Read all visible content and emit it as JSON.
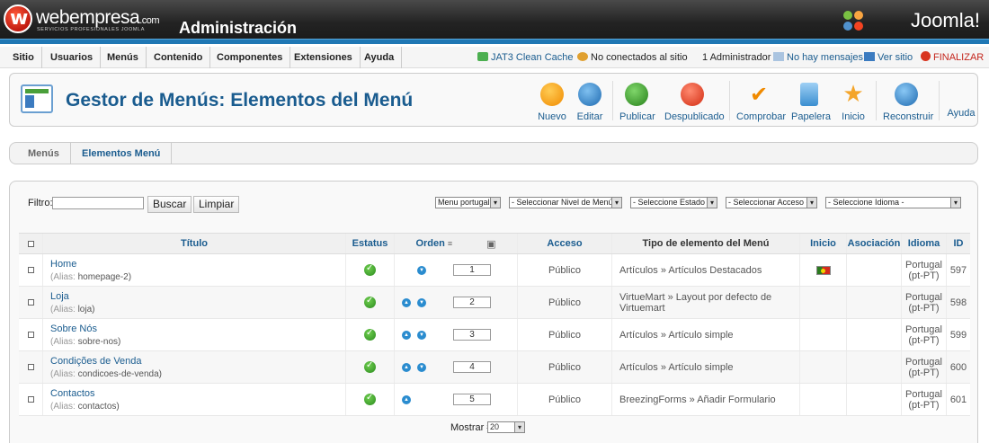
{
  "header": {
    "brand": "webempresa",
    "brand_suffix": ".com",
    "brand_tagline": "SERVICIOS PROFESIONALES JOOMLA",
    "admin_title": "Administración",
    "joomla_logo": "Joomla!"
  },
  "menubar": {
    "items": [
      "Sitio",
      "Usuarios",
      "Menús",
      "Contenido",
      "Componentes",
      "Extensiones",
      "Ayuda"
    ],
    "status": {
      "cache": "JAT3 Clean Cache",
      "visitors": "No conectados al sitio",
      "admins": "1 Administrador",
      "messages": "No hay mensajes",
      "view_site": "Ver sitio",
      "logout": "FINALIZAR"
    }
  },
  "toolbar": {
    "title": "Gestor de Menús: Elementos del Menú",
    "buttons": {
      "new": "Nuevo",
      "edit": "Editar",
      "publish": "Publicar",
      "unpublish": "Despublicado",
      "checkin": "Comprobar",
      "trash": "Papelera",
      "home": "Inicio",
      "rebuild": "Reconstruir",
      "help": "Ayuda"
    }
  },
  "tabs": {
    "menus": "Menús",
    "items": "Elementos Menú"
  },
  "filters": {
    "label": "Filtro:",
    "search_btn": "Buscar",
    "clear_btn": "Limpiar",
    "menu_select": "Menu portugal",
    "level_select": "- Seleccionar Nivel de Menú -",
    "state_select": "- Seleccione Estado -",
    "access_select": "- Seleccionar Acceso -",
    "language_select": "- Seleccione Idioma -"
  },
  "table": {
    "headers": {
      "title": "Título",
      "status": "Estatus",
      "order": "Orden",
      "access": "Acceso",
      "type": "Tipo de elemento del Menú",
      "home": "Inicio",
      "association": "Asociación",
      "language": "Idioma",
      "id": "ID"
    },
    "alias_label": "(Alias:",
    "rows": [
      {
        "title": "Home",
        "alias": "homepage-2)",
        "order": "1",
        "access": "Público",
        "type": "Artículos » Artículos Destacados",
        "lang1": "Portugal",
        "lang2": "(pt-PT)",
        "id": "597"
      },
      {
        "title": "Loja",
        "alias": "loja)",
        "order": "2",
        "access": "Público",
        "type": "VirtueMart » Layout por defecto de Virtuemart",
        "lang1": "Portugal",
        "lang2": "(pt-PT)",
        "id": "598"
      },
      {
        "title": "Sobre Nós",
        "alias": "sobre-nos)",
        "order": "3",
        "access": "Público",
        "type": "Artículos » Artículo simple",
        "lang1": "Portugal",
        "lang2": "(pt-PT)",
        "id": "599"
      },
      {
        "title": "Condições de Venda",
        "alias": "condicoes-de-venda)",
        "order": "4",
        "access": "Público",
        "type": "Artículos » Artículo simple",
        "lang1": "Portugal",
        "lang2": "(pt-PT)",
        "id": "600"
      },
      {
        "title": "Contactos",
        "alias": "contactos)",
        "order": "5",
        "access": "Público",
        "type": "BreezingForms » Añadir Formulario",
        "lang1": "Portugal",
        "lang2": "(pt-PT)",
        "id": "601"
      }
    ]
  },
  "pagination": {
    "show_label": "Mostrar #",
    "show_value": "20"
  }
}
